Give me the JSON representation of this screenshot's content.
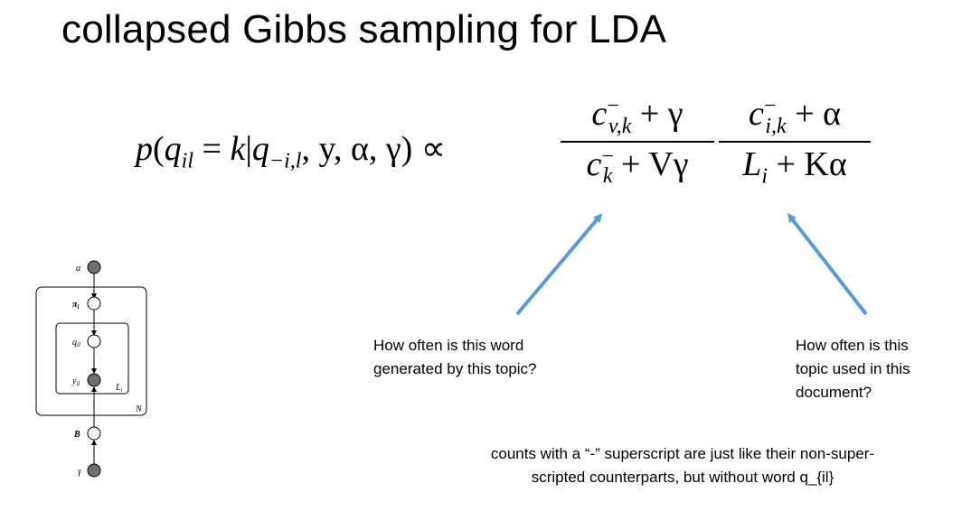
{
  "slide": {
    "title": "collapsed Gibbs sampling for LDA"
  },
  "equation": {
    "lhs_p": "p",
    "lhs_q": "q",
    "lhs_q_sub": "il",
    "lhs_eq": " = ",
    "lhs_k": "k",
    "lhs_bar": "|",
    "lhs_q2": "q",
    "lhs_q2_sub": "−i,l",
    "lhs_rest": ", y, α, γ) ∝",
    "frac1_num": "c",
    "frac1_num_sup": "−",
    "frac1_num_sub": "v,k",
    "frac1_num_rest": " + γ",
    "frac1_den": "c",
    "frac1_den_sup": "−",
    "frac1_den_sub": "k",
    "frac1_den_rest": " + Vγ",
    "frac2_num": "c",
    "frac2_num_sup": "−",
    "frac2_num_sub": "i,k",
    "frac2_num_rest": " + α",
    "frac2_den": "L",
    "frac2_den_sub": "i",
    "frac2_den_rest": " + Kα"
  },
  "annotations": {
    "left_line1": "How often is this word",
    "left_line2": "generated by this topic?",
    "right_line1": "How often is this",
    "right_line2": "topic used in this",
    "right_line3": "document?",
    "arrow_color": "#5b9bd5"
  },
  "note": {
    "line1": "counts with a “-” superscript are just like their non-super-",
    "line2": "scripted counterparts, but without word q_{il}"
  },
  "graphical_model": {
    "alpha": "α",
    "pi": "π",
    "pi_sub": "i",
    "q": "q",
    "q_sub": "il",
    "y": "y",
    "y_sub": "il",
    "L": "L",
    "L_sub": "i",
    "N": "N",
    "B": "B",
    "gamma": "γ",
    "shaded_color": "#6e6e6e"
  }
}
